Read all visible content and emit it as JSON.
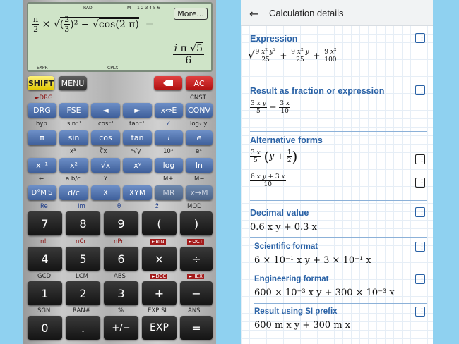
{
  "calculator": {
    "indicators": {
      "rad": "RAD",
      "m": "M",
      "mem": "1 2 3 4 5 6",
      "expr": "EXPR",
      "cplx": "CPLX"
    },
    "more_label": "More...",
    "expression": "π/2 × √((2/3)² − √cos(2 π)) =",
    "result": "i π √5 / 6",
    "row0": {
      "shift": "SHIFT",
      "menu": "MENU",
      "del_icon": "backspace-icon",
      "ac": "AC"
    },
    "row1_labels_above": {
      "drg": "►DRG",
      "cnst": "CNST"
    },
    "row1": [
      "DRG",
      "FSE",
      "◄",
      "►",
      "x⇔E",
      "CONV"
    ],
    "row2_labels_above": [
      "hyp",
      "sin⁻¹",
      "cos⁻¹",
      "tan⁻¹",
      "∠",
      "logₓ y"
    ],
    "row2": [
      "π",
      "sin",
      "cos",
      "tan",
      "i",
      "e"
    ],
    "row3_labels_above": [
      "x³",
      "∛x",
      "ˣ√y",
      "10ˣ",
      "eˣ"
    ],
    "row3": [
      "x⁻¹",
      "x²",
      "√x",
      "xʸ",
      "log",
      "ln"
    ],
    "row4_labels_above": [
      "←",
      "a b/c",
      "Y",
      "M+",
      "M−"
    ],
    "row4": [
      "D°M′S",
      "d/c",
      "X",
      "XYM",
      "MR",
      "x→M"
    ],
    "row5_labels_above": [
      "Re",
      "Im",
      "θ",
      "z̄",
      "MOD"
    ],
    "row5": [
      "7",
      "8",
      "9",
      "(",
      ")"
    ],
    "row6_labels_above": [
      "n!",
      "nCr",
      "nPr",
      "►BIN",
      "►OCT"
    ],
    "row6": [
      "4",
      "5",
      "6",
      "×",
      "÷"
    ],
    "row7_labels_above": [
      "GCD",
      "LCM",
      "ABS",
      "►DEC",
      "►HEX"
    ],
    "row7": [
      "1",
      "2",
      "3",
      "+",
      "−"
    ],
    "row8_labels_above": [
      "SGN",
      "RAN#",
      "%",
      "EXP SI",
      "ANS"
    ],
    "row8": [
      "0",
      ".",
      "+/−",
      "EXP",
      "="
    ]
  },
  "panel": {
    "title": "Calculation details",
    "back_icon": "back-arrow-icon",
    "sections": {
      "expression": "Expression",
      "fraction": "Result as fraction or expression",
      "alternative": "Alternative forms",
      "decimal": "Decimal value",
      "scientific": "Scientific format",
      "engineering": "Engineering format",
      "si": "Result using SI prefix"
    },
    "values": {
      "decimal": "0.6 x y + 0.3 x",
      "scientific": "6 × 10⁻¹ x y + 3 × 10⁻¹ x",
      "engineering": "600 × 10⁻³ x y + 300 × 10⁻³ x",
      "si": "600 m x y + 300 m x"
    }
  }
}
